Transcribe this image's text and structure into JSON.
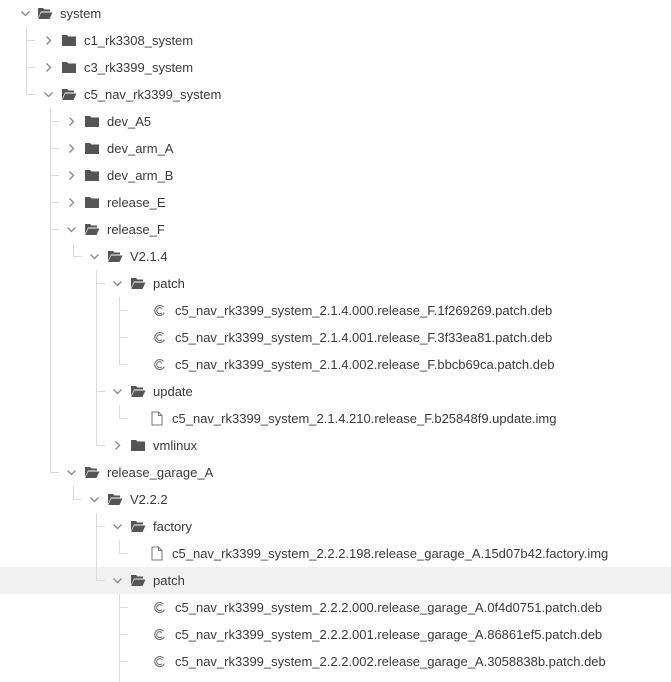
{
  "tree": {
    "nodes": [
      {
        "label": "system",
        "depth": 0,
        "kind": "folder",
        "expanded": true
      },
      {
        "label": "c1_rk3308_system",
        "depth": 1,
        "kind": "folder",
        "expanded": false
      },
      {
        "label": "c3_rk3399_system",
        "depth": 1,
        "kind": "folder",
        "expanded": false
      },
      {
        "label": "c5_nav_rk3399_system",
        "depth": 1,
        "kind": "folder",
        "expanded": true
      },
      {
        "label": "dev_A5",
        "depth": 2,
        "kind": "folder",
        "expanded": false
      },
      {
        "label": "dev_arm_A",
        "depth": 2,
        "kind": "folder",
        "expanded": false
      },
      {
        "label": "dev_arm_B",
        "depth": 2,
        "kind": "folder",
        "expanded": false
      },
      {
        "label": "release_E",
        "depth": 2,
        "kind": "folder",
        "expanded": false
      },
      {
        "label": "release_F",
        "depth": 2,
        "kind": "folder",
        "expanded": true
      },
      {
        "label": "V2.1.4",
        "depth": 3,
        "kind": "folder",
        "expanded": true
      },
      {
        "label": "patch",
        "depth": 4,
        "kind": "folder",
        "expanded": true
      },
      {
        "label": "c5_nav_rk3399_system_2.1.4.000.release_F.1f269269.patch.deb",
        "depth": 5,
        "kind": "deb"
      },
      {
        "label": "c5_nav_rk3399_system_2.1.4.001.release_F.3f33ea81.patch.deb",
        "depth": 5,
        "kind": "deb"
      },
      {
        "label": "c5_nav_rk3399_system_2.1.4.002.release_F.bbcb69ca.patch.deb",
        "depth": 5,
        "kind": "deb"
      },
      {
        "label": "update",
        "depth": 4,
        "kind": "folder",
        "expanded": true
      },
      {
        "label": "c5_nav_rk3399_system_2.1.4.210.release_F.b25848f9.update.img",
        "depth": 5,
        "kind": "file"
      },
      {
        "label": "vmlinux",
        "depth": 4,
        "kind": "folder",
        "expanded": false
      },
      {
        "label": "release_garage_A",
        "depth": 2,
        "kind": "folder",
        "expanded": true
      },
      {
        "label": "V2.2.2",
        "depth": 3,
        "kind": "folder",
        "expanded": true
      },
      {
        "label": "factory",
        "depth": 4,
        "kind": "folder",
        "expanded": true
      },
      {
        "label": "c5_nav_rk3399_system_2.2.2.198.release_garage_A.15d07b42.factory.img",
        "depth": 5,
        "kind": "file"
      },
      {
        "label": "patch",
        "depth": 4,
        "kind": "folder",
        "expanded": true,
        "hovered": true
      },
      {
        "label": "c5_nav_rk3399_system_2.2.2.000.release_garage_A.0f4d0751.patch.deb",
        "depth": 5,
        "kind": "deb"
      },
      {
        "label": "c5_nav_rk3399_system_2.2.2.001.release_garage_A.86861ef5.patch.deb",
        "depth": 5,
        "kind": "deb"
      },
      {
        "label": "c5_nav_rk3399_system_2.2.2.002.release_garage_A.3058838b.patch.deb",
        "depth": 5,
        "kind": "deb"
      }
    ],
    "colors": {
      "folder": "#555555",
      "chevron": "#888888",
      "guide": "#dcdcdc",
      "hover_row": "#f1f1f1",
      "text": "#3a3a3a"
    }
  }
}
